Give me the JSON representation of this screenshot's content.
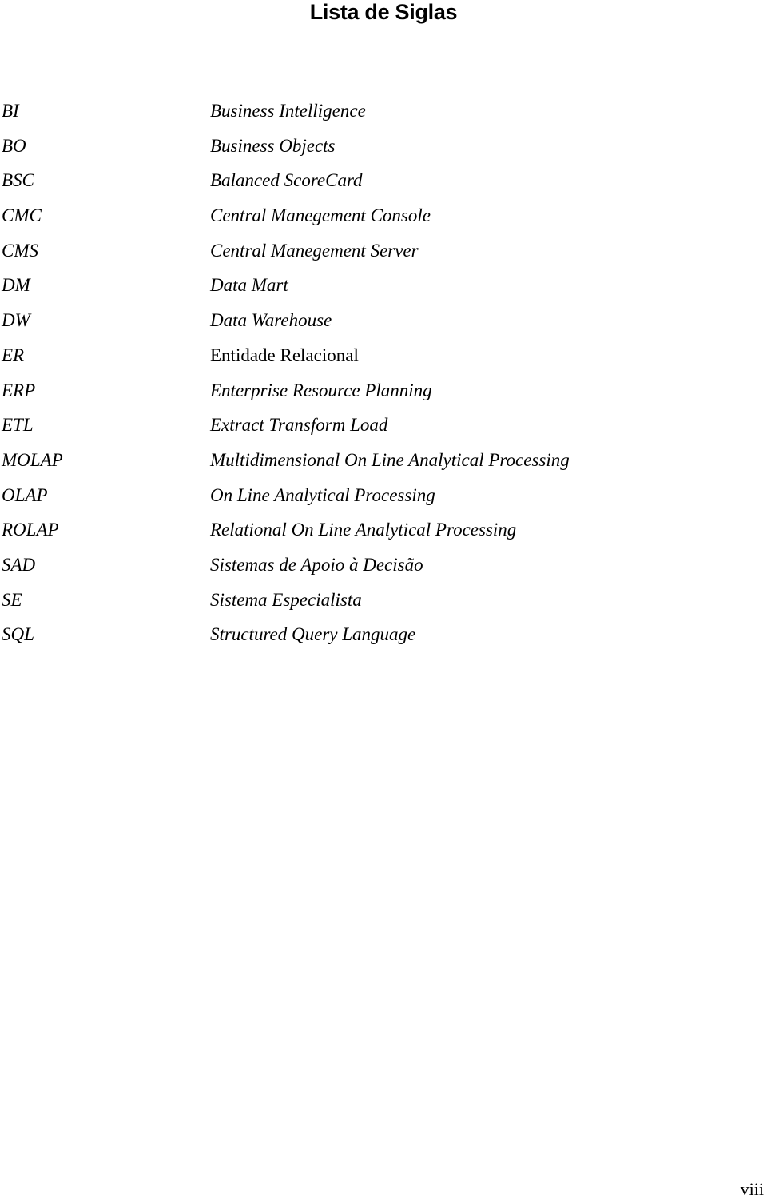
{
  "page": {
    "title": "Lista de Siglas",
    "page_number": "viii"
  },
  "acronyms": [
    {
      "abbr": "BI",
      "definition": "Business Intelligence",
      "italic": true
    },
    {
      "abbr": "BO",
      "definition": "Business Objects",
      "italic": true
    },
    {
      "abbr": "BSC",
      "definition": "Balanced ScoreCard",
      "italic": true
    },
    {
      "abbr": "CMC",
      "definition": "Central Manegement Console",
      "italic": true
    },
    {
      "abbr": "CMS",
      "definition": "Central Manegement Server",
      "italic": true
    },
    {
      "abbr": "DM",
      "definition": "Data Mart",
      "italic": true
    },
    {
      "abbr": "DW",
      "definition": "Data Warehouse",
      "italic": true
    },
    {
      "abbr": "ER",
      "definition": "Entidade Relacional",
      "italic": false
    },
    {
      "abbr": "ERP",
      "definition": "Enterprise Resource Planning",
      "italic": true
    },
    {
      "abbr": "ETL",
      "definition": "Extract Transform Load",
      "italic": true
    },
    {
      "abbr": "MOLAP",
      "definition": "Multidimensional On Line Analytical Processing",
      "italic": true
    },
    {
      "abbr": "OLAP",
      "definition": "On Line Analytical Processing",
      "italic": true
    },
    {
      "abbr": "ROLAP",
      "definition": "Relational On Line Analytical Processing",
      "italic": true
    },
    {
      "abbr": "SAD",
      "definition": "Sistemas de Apoio à Decisão",
      "italic": true
    },
    {
      "abbr": "SE",
      "definition": "Sistema Especialista",
      "italic": true
    },
    {
      "abbr": "SQL",
      "definition": "Structured Query Language",
      "italic": true
    }
  ]
}
